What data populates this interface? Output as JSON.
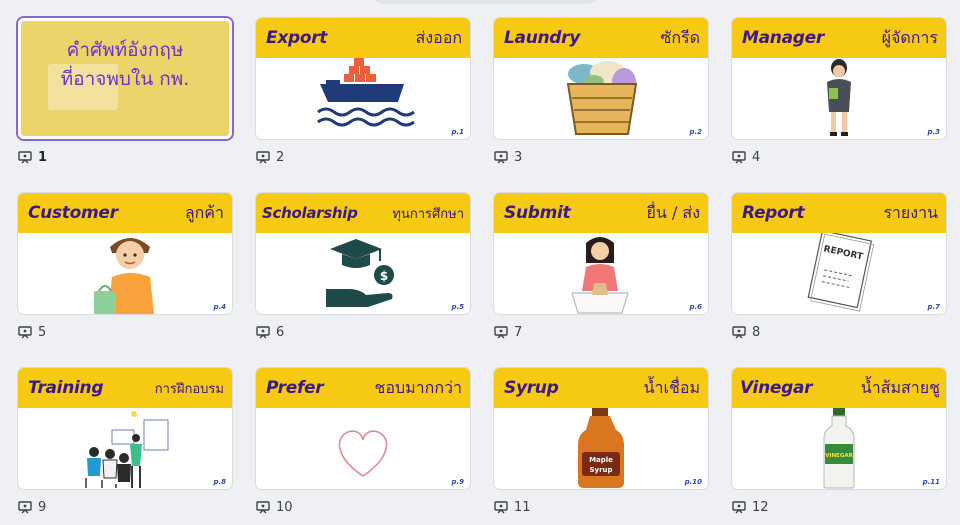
{
  "cover": {
    "line1": "คำศัพท์อังกฤษ",
    "line2": "ที่อาจพบใน กพ.",
    "number": "1"
  },
  "slides": [
    {
      "number": "2",
      "en": "Export",
      "th": "ส่งออก",
      "page": "p.1",
      "icon": "cargo-ship-icon"
    },
    {
      "number": "3",
      "en": "Laundry",
      "th": "ซักรีด",
      "page": "p.2",
      "icon": "laundry-basket-icon"
    },
    {
      "number": "4",
      "en": "Manager",
      "th": "ผู้จัดการ",
      "page": "p.3",
      "icon": "businesswoman-icon"
    },
    {
      "number": "5",
      "en": "Customer",
      "th": "ลูกค้า",
      "page": "p.4",
      "icon": "customer-shopping-icon"
    },
    {
      "number": "6",
      "en": "Scholarship",
      "th": "ทุนการศึกษา",
      "page": "p.5",
      "icon": "scholarship-hand-icon"
    },
    {
      "number": "7",
      "en": "Submit",
      "th": "ยื่น / ส่ง",
      "page": "p.6",
      "icon": "submit-document-icon"
    },
    {
      "number": "8",
      "en": "Report",
      "th": "รายงาน",
      "page": "p.7",
      "icon": "report-document-icon"
    },
    {
      "number": "9",
      "en": "Training",
      "th": "การฝึกอบรม",
      "page": "p.8",
      "icon": "training-class-icon"
    },
    {
      "number": "10",
      "en": "Prefer",
      "th": "ชอบมากกว่า",
      "page": "p.9",
      "icon": "heart-icon"
    },
    {
      "number": "11",
      "en": "Syrup",
      "th": "น้ำเชื่อม",
      "page": "p.10",
      "icon": "syrup-bottle-icon"
    },
    {
      "number": "12",
      "en": "Vinegar",
      "th": "น้ำส้มสายชู",
      "page": "p.11",
      "icon": "vinegar-bottle-icon"
    }
  ],
  "art_text": {
    "report": "REPORT",
    "maple": "Maple",
    "syrup": "Syrup",
    "vinegar": "VINEGAR"
  },
  "colors": {
    "banner": "#f6c913",
    "title_text": "#3b1a86",
    "cover_bg": "#ecd36a",
    "selected_border": "#8a63d2"
  }
}
